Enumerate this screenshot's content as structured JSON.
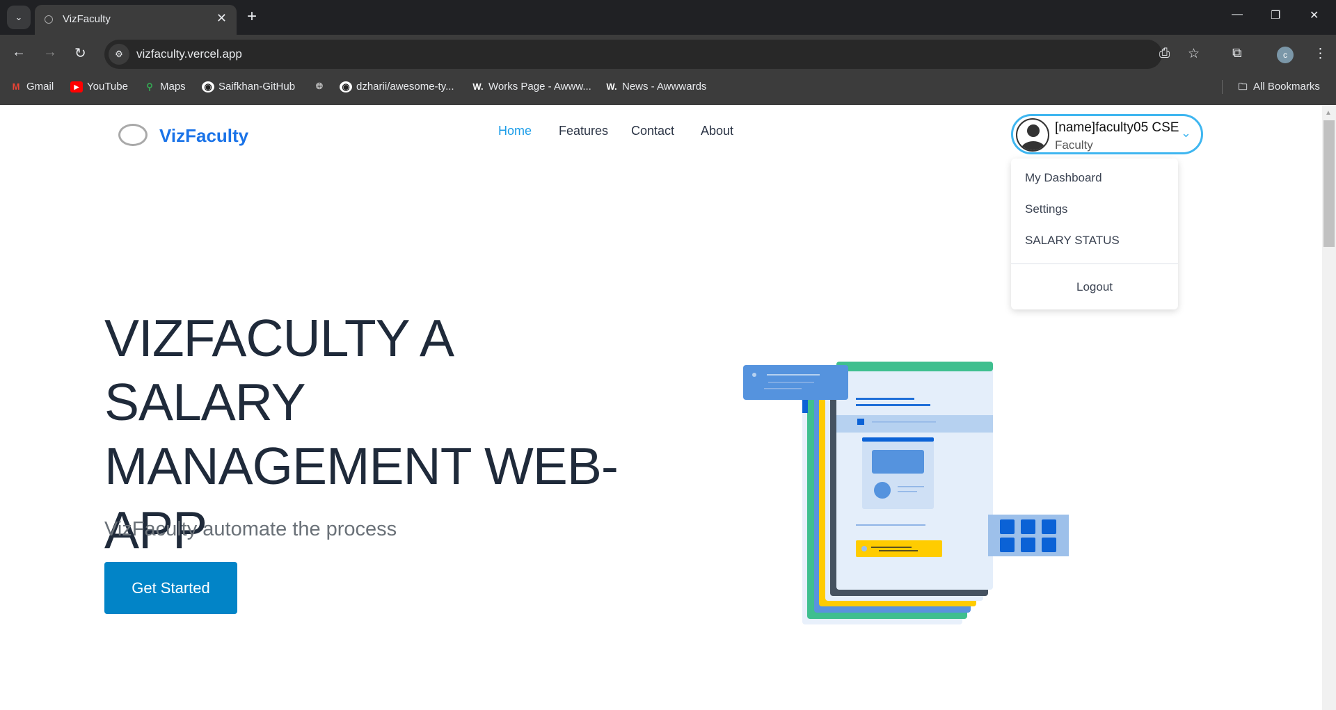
{
  "browser": {
    "tab_title": "VizFaculty",
    "url": "vizfaculty.vercel.app",
    "bookmarks": [
      {
        "label": "Gmail",
        "icon": "gmail-icon"
      },
      {
        "label": "YouTube",
        "icon": "youtube-icon"
      },
      {
        "label": "Maps",
        "icon": "maps-icon"
      },
      {
        "label": "Saifkhan-GitHub",
        "icon": "github-icon"
      },
      {
        "label": "",
        "icon": "globe-icon"
      },
      {
        "label": "dzharii/awesome-ty...",
        "icon": "github-icon"
      },
      {
        "label": "Works Page - Awww...",
        "icon": "awwwards-icon"
      },
      {
        "label": "News - Awwwards",
        "icon": "awwwards-icon"
      }
    ],
    "all_bookmarks": "All Bookmarks",
    "profile_initial": "c"
  },
  "header": {
    "brand": "VizFaculty",
    "logo_text": "VizFaculty",
    "nav": [
      {
        "label": "Home",
        "active": true
      },
      {
        "label": "Features"
      },
      {
        "label": "Contact"
      },
      {
        "label": "About"
      }
    ],
    "user": {
      "name": "[name]faculty05 CSE",
      "role": "Faculty"
    },
    "dropdown": [
      "My Dashboard",
      "Settings",
      "SALARY STATUS"
    ],
    "logout": "Logout"
  },
  "hero": {
    "title": "VIZFACULTY A SALARY MANAGEMENT WEB-APP",
    "subtitle": "VizFaculty automate the process",
    "cta": "Get Started"
  },
  "colors": {
    "accent": "#1a73e8",
    "button": "#0284c7",
    "pill_border": "#3fb6f0"
  }
}
